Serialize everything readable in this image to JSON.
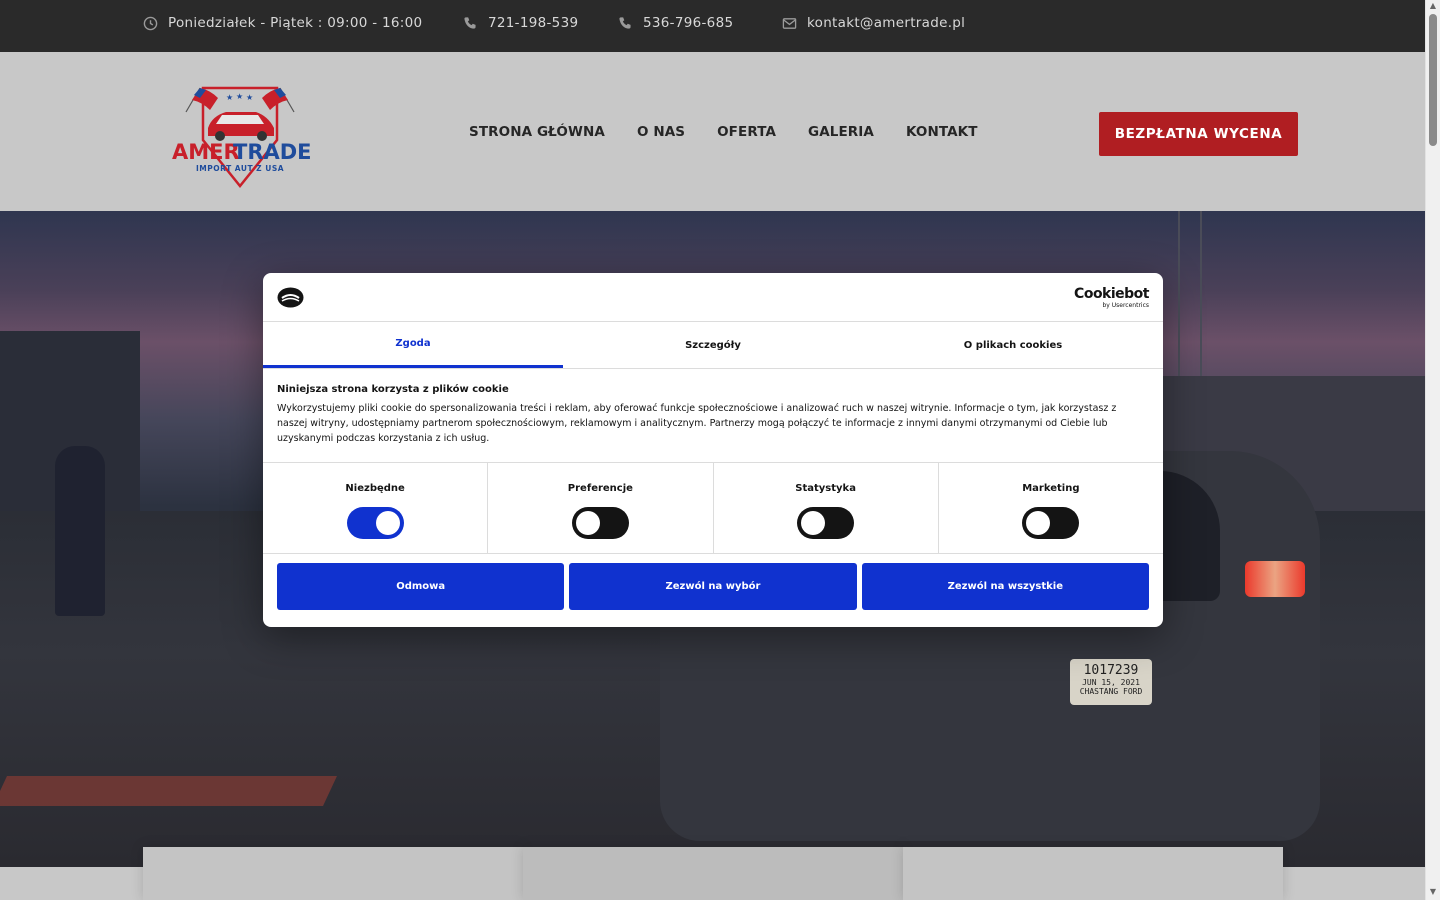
{
  "topbar": {
    "hours": "Poniedziałek - Piątek : 09:00 - 16:00",
    "phone1": "721-198-539",
    "phone2": "536-796-685",
    "email": "kontakt@amertrade.pl"
  },
  "logo": {
    "name_amer": "AMER",
    "name_trade": "TRADE",
    "tagline": "IMPORT AUT Z USA"
  },
  "nav": {
    "items": [
      "STRONA GŁÓWNA",
      "O NAS",
      "OFERTA",
      "GALERIA",
      "KONTAKT"
    ]
  },
  "cta": {
    "label": "BEZPŁATNA WYCENA"
  },
  "hero": {
    "plate_number": "1017239",
    "plate_date": "JUN 15, 2021",
    "plate_dealer": "CHASTANG FORD"
  },
  "cookie_dialog": {
    "brand": "Cookiebot",
    "brand_sub": "by Usercentrics",
    "tabs": [
      "Zgoda",
      "Szczegóły",
      "O plikach cookies"
    ],
    "active_tab": "Zgoda",
    "title": "Niniejsza strona korzysta z plików cookie",
    "text": "Wykorzystujemy pliki cookie do spersonalizowania treści i reklam, aby oferować funkcje społecznościowe i analizować ruch w naszej witrynie. Informacje o tym, jak korzystasz z naszej witryny, udostępniamy partnerom społecznościowym, reklamowym i analitycznym. Partnerzy mogą połączyć te informacje z innymi danymi otrzymanymi od Ciebie lub uzyskanymi podczas korzystania z ich usług.",
    "toggles": [
      {
        "label": "Niezbędne",
        "on": true
      },
      {
        "label": "Preferencje",
        "on": false
      },
      {
        "label": "Statystyka",
        "on": false
      },
      {
        "label": "Marketing",
        "on": false
      }
    ],
    "buttons": [
      "Odmowa",
      "Zezwól na wybór",
      "Zezwól na wszystkie"
    ]
  },
  "colors": {
    "accent_red": "#b01e22",
    "cookiebot_blue": "#1032cf",
    "topbar_bg": "#2a2a2a",
    "header_bg": "#c8c8c8"
  }
}
